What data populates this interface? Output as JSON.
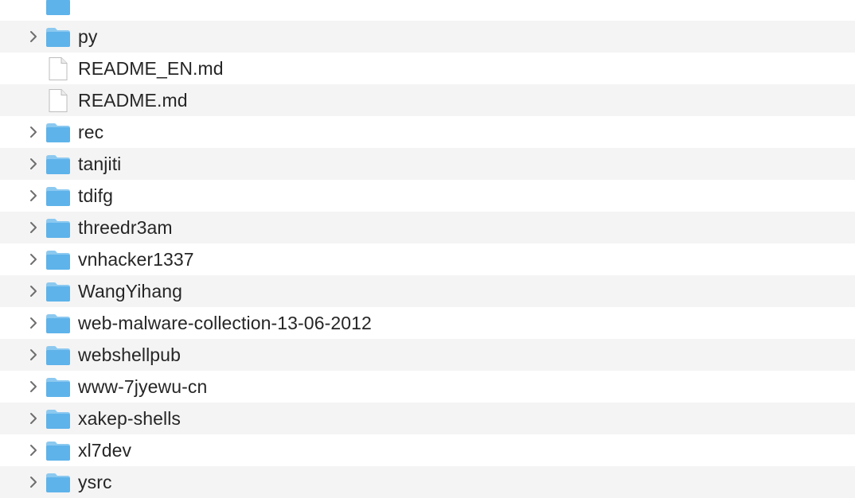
{
  "file_list": {
    "items": [
      {
        "name": "",
        "kind": "folder",
        "cut_off": true
      },
      {
        "name": "py",
        "kind": "folder"
      },
      {
        "name": "README_EN.md",
        "kind": "file"
      },
      {
        "name": "README.md",
        "kind": "file"
      },
      {
        "name": "rec",
        "kind": "folder"
      },
      {
        "name": "tanjiti",
        "kind": "folder"
      },
      {
        "name": "tdifg",
        "kind": "folder"
      },
      {
        "name": "threedr3am",
        "kind": "folder"
      },
      {
        "name": "vnhacker1337",
        "kind": "folder"
      },
      {
        "name": "WangYihang",
        "kind": "folder"
      },
      {
        "name": "web-malware-collection-13-06-2012",
        "kind": "folder"
      },
      {
        "name": "webshellpub",
        "kind": "folder"
      },
      {
        "name": "www-7jyewu-cn",
        "kind": "folder"
      },
      {
        "name": "xakep-shells",
        "kind": "folder"
      },
      {
        "name": "xl7dev",
        "kind": "folder"
      },
      {
        "name": "ysrc",
        "kind": "folder"
      }
    ]
  },
  "colors": {
    "row_alt": "#f4f4f4",
    "row_white": "#ffffff",
    "folder_body": "#5eb3ea",
    "folder_tab": "#8cc9f0",
    "text": "#262626",
    "chevron": "#6e6e6e"
  },
  "icons": {
    "folder": "folder-icon",
    "file": "document-icon",
    "disclosure": "chevron-right-icon"
  }
}
